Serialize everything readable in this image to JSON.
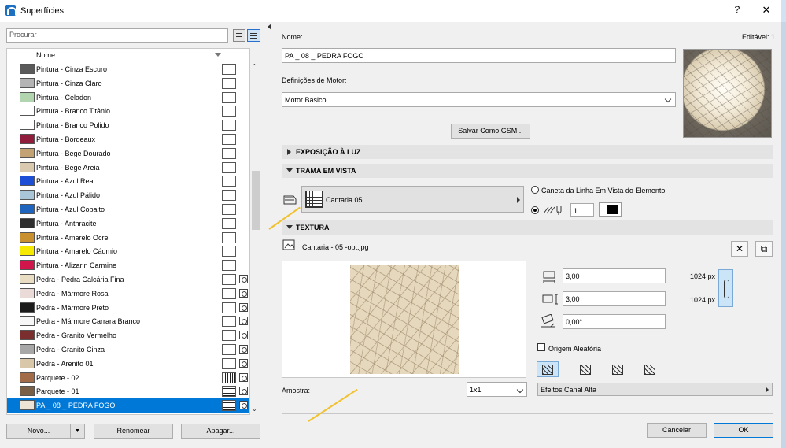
{
  "window": {
    "title": "Superfícies",
    "help": "?",
    "close": "✕"
  },
  "left": {
    "search_placeholder": "Procurar",
    "column_header": "Nome",
    "items": [
      {
        "name": "Pintura - Cinza Escuro",
        "color": "#5a5a5a",
        "tex": false
      },
      {
        "name": "Pintura - Cinza Claro",
        "color": "#b4b4b4",
        "tex": false
      },
      {
        "name": "Pintura - Celadon",
        "color": "#b2d5b0",
        "tex": false
      },
      {
        "name": "Pintura - Branco Titânio",
        "color": "#ffffff",
        "tex": false
      },
      {
        "name": "Pintura - Branco Polido",
        "color": "#ffffff",
        "tex": false
      },
      {
        "name": "Pintura - Bordeaux",
        "color": "#8f1d3b",
        "tex": false
      },
      {
        "name": "Pintura - Bege Dourado",
        "color": "#c3a273",
        "tex": false
      },
      {
        "name": "Pintura - Bege Areia",
        "color": "#d9c9ae",
        "tex": false
      },
      {
        "name": "Pintura - Azul Real",
        "color": "#1d4fd6",
        "tex": false
      },
      {
        "name": "Pintura - Azul Pálido",
        "color": "#a9c6d9",
        "tex": false
      },
      {
        "name": "Pintura - Azul Cobalto",
        "color": "#1f64bd",
        "tex": false
      },
      {
        "name": "Pintura - Anthracite",
        "color": "#2f2f2f",
        "tex": false
      },
      {
        "name": "Pintura - Amarelo Ocre",
        "color": "#c8902f",
        "tex": false
      },
      {
        "name": "Pintura - Amarelo Cádmio",
        "color": "#f5e900",
        "tex": false
      },
      {
        "name": "Pintura - Alizarin Carmine",
        "color": "#d0164a",
        "tex": false
      },
      {
        "name": "Pedra - Pedra Calcária Fina",
        "color": "#e8dcc3",
        "tex": true
      },
      {
        "name": "Pedra - Mármore Rosa",
        "color": "#eadbd9",
        "tex": true
      },
      {
        "name": "Pedra - Mármore Preto",
        "color": "#1b1b1b",
        "tex": true
      },
      {
        "name": "Pedra - Mármore Carrara Branco",
        "color": "#f7f7f7",
        "tex": true
      },
      {
        "name": "Pedra - Granito Vermelho",
        "color": "#7a2e2e",
        "tex": true
      },
      {
        "name": "Pedra - Granito Cinza",
        "color": "#a7a7a7",
        "tex": true
      },
      {
        "name": "Pedra - Arenito 01",
        "color": "#d8c7a9",
        "tex": true
      },
      {
        "name": "Parquete - 02",
        "color": "#a26c48",
        "tex": true
      },
      {
        "name": "Parquete - 01",
        "color": "#7a5f47",
        "tex": true
      },
      {
        "name": "PA _ 08 _ PEDRA FOGO",
        "color": "#ede4d6",
        "tex": true
      }
    ],
    "buttons": {
      "new": "Novo...",
      "rename": "Renomear",
      "delete": "Apagar..."
    }
  },
  "right": {
    "name_label": "Nome:",
    "editable": "Editável: 1",
    "name_value": "PA _ 08 _ PEDRA FOGO",
    "engine_label": "Definições de Motor:",
    "engine_value": "Motor Básico",
    "save_gsm": "Salvar Como GSM...",
    "sections": {
      "light": "EXPOSIÇÃO À LUZ",
      "hatch": "TRAMA EM VISTA",
      "texture": "TEXTURA"
    },
    "hatch_name": "Cantaria 05",
    "pen_option": "Caneta da Linha Em Vista do Elemento",
    "pen_number": "1",
    "texture_file": "Cantaria - 05 -opt.jpg",
    "width_value": "3,00",
    "height_value": "3,00",
    "angle_value": "0,00°",
    "px_width": "1024 px",
    "px_height": "1024 px",
    "random_origin": "Origem Aleatória",
    "alpha_effects": "Efeitos Canal Alfa",
    "sample_label": "Amostra:",
    "sample_value": "1x1",
    "cancel": "Cancelar",
    "ok": "OK"
  }
}
